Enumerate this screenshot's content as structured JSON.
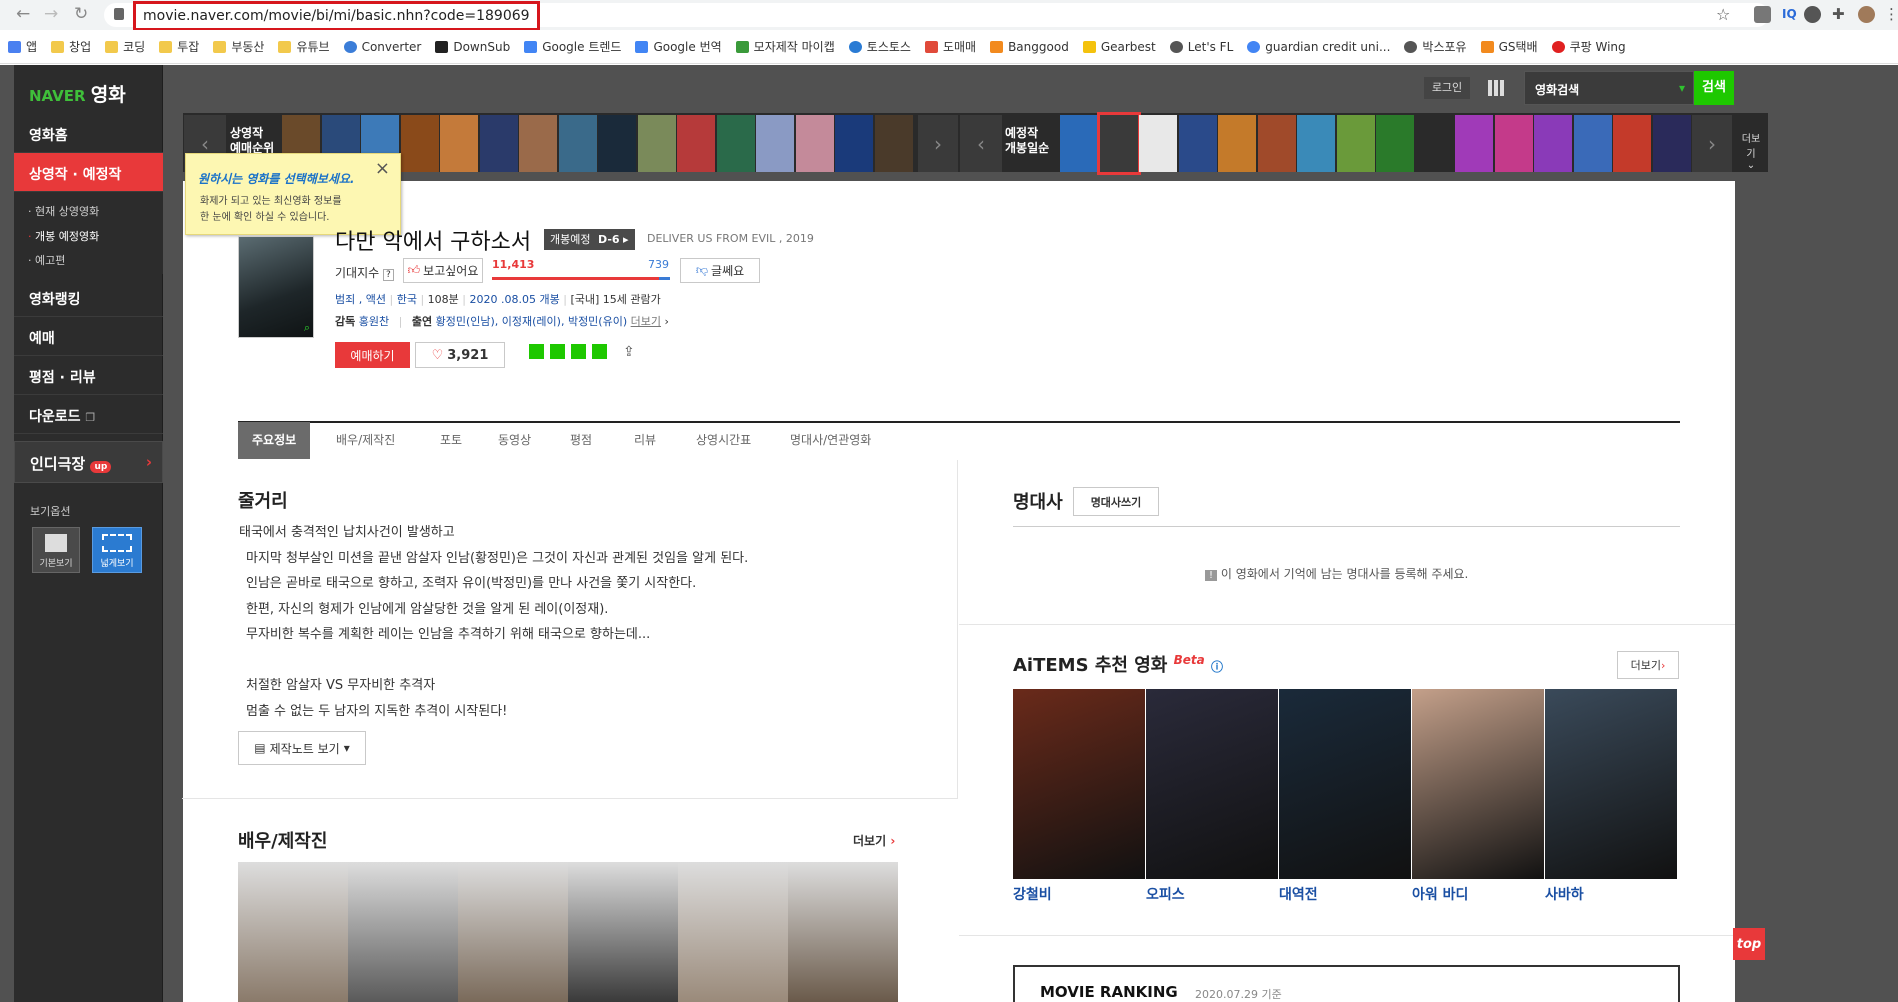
{
  "browser": {
    "url": "movie.naver.com/movie/bi/mi/basic.nhn?code=189069",
    "bookmarks": [
      "앱",
      "창업",
      "코딩",
      "투잡",
      "부동산",
      "유튜브",
      "Converter",
      "DownSub",
      "Google 트렌드",
      "Google 번역",
      "모자제작 마이캡",
      "토스토스",
      "도매매",
      "Banggood",
      "Gearbest",
      "Let's FL",
      "guardian credit uni...",
      "박스포유",
      "GS택배",
      "쿠팡 Wing"
    ]
  },
  "header": {
    "logo_brand": "NAVER",
    "logo_service": "영화",
    "login": "로그인",
    "search_category": "영화검색",
    "search_button": "검색"
  },
  "lnb": {
    "home": "영화홈",
    "current": "상영작 · 예정작",
    "sub": [
      "현재 상영영화",
      "개봉 예정영화",
      "예고편"
    ],
    "ranking": "영화랭킹",
    "booking": "예매",
    "reviews": "평점 · 리뷰",
    "download": "다운로드",
    "indie": "인디극장",
    "indie_badge": "up",
    "view_option": "보기옵션",
    "view_basic": "기본보기",
    "view_wide": "넓게보기"
  },
  "strip": {
    "now_label_1": "상영작",
    "now_label_2": "예매순위",
    "coming_label_1": "예정작",
    "coming_label_2": "개봉일순",
    "more": "더보기"
  },
  "tooltip": {
    "title": "원하시는 영화를 선택해보세요.",
    "body_1": "화제가 되고 있는 최신영화 정보를",
    "body_2": "한 눈에 확인 하실 수 있습니다."
  },
  "movie": {
    "title": "다만 악에서 구하소서",
    "status": "개봉예정",
    "dday": "D-6",
    "eng_title": "DELIVER US FROM EVIL , 2019",
    "expect_label": "기대지수",
    "want_label": "보고싶어요",
    "want_count": "11,413",
    "nope_count": "739",
    "nope_label": "글쎄요",
    "genre": "범죄 , 액션",
    "country": "한국",
    "runtime": "108분",
    "release": "2020 .08.05 개봉",
    "rating": "[국내] 15세 관람가",
    "director_label": "감독",
    "director": "홍원찬",
    "cast_label": "출연",
    "cast": "황정민(인남), 이정재(레이), 박정민(유이)",
    "cast_more": "더보기",
    "book_button": "예매하기",
    "likes": "3,921"
  },
  "tabs": [
    "주요정보",
    "배우/제작진",
    "포토",
    "동영상",
    "평점",
    "리뷰",
    "상영시간표",
    "명대사/연관영화"
  ],
  "synopsis": {
    "heading": "줄거리",
    "lines": [
      "태국에서 충격적인 납치사건이 발생하고",
      "마지막 청부살인 미션을 끝낸 암살자 인남(황정민)은 그것이 자신과 관계된 것임을 알게 된다.",
      "인남은 곧바로 태국으로 향하고, 조력자 유이(박정민)를 만나 사건을 쫓기 시작한다.",
      "한편, 자신의 형제가 인남에게 암살당한 것을 알게 된 레이(이정재).",
      "무자비한 복수를 계획한 레이는 인남을 추격하기 위해 태국으로 향하는데...",
      "",
      "처절한 암살자 VS 무자비한 추격자",
      "멈출 수 없는 두 남자의 지독한 추격이 시작된다!"
    ],
    "notes_button": "제작노트 보기"
  },
  "quotes": {
    "heading": "명대사",
    "write_button": "명대사쓰기",
    "empty": "이 영화에서 기억에 남는 명대사를 등록해 주세요."
  },
  "aitems": {
    "heading": "AiTEMS 추천 영화",
    "beta": "Beta",
    "more": "더보기",
    "movies": [
      "강철비",
      "오피스",
      "대역전",
      "아워 바디",
      "사바하"
    ]
  },
  "cast_section": {
    "heading": "배우/제작진",
    "more": "더보기"
  },
  "ranking": {
    "heading": "MOVIE RANKING",
    "date": "2020.07.29 기준"
  },
  "top_button": "top"
}
